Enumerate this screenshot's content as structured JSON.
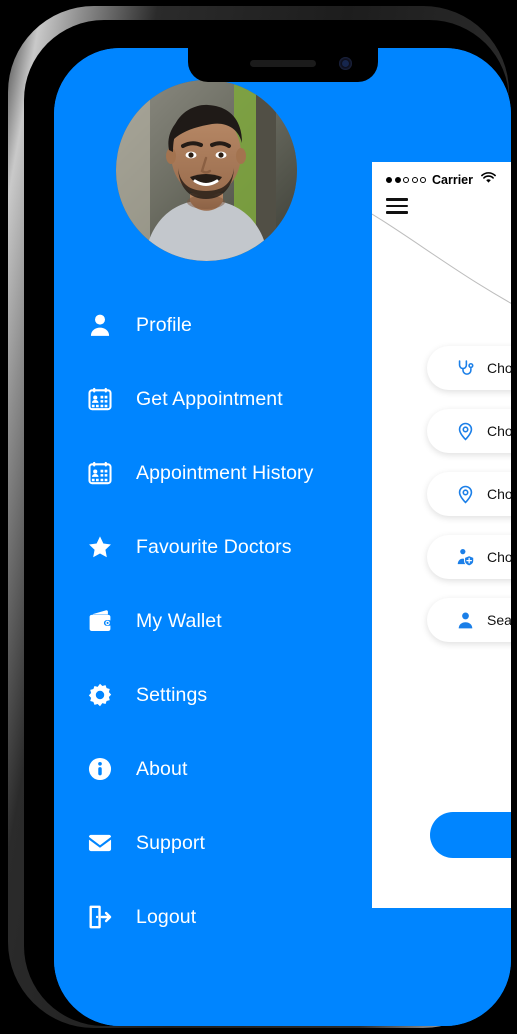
{
  "app": {
    "accent_color": "#0085ff",
    "panel_color": "#ffffff"
  },
  "drawer": {
    "avatar": {
      "icon": "user-photo-avatar",
      "alt": "Profile photo of a smiling man in a grey t-shirt"
    },
    "items": [
      {
        "icon": "person-icon",
        "label": "Profile"
      },
      {
        "icon": "calendar-icon",
        "label": "Get Appointment"
      },
      {
        "icon": "calendar-icon",
        "label": "Appointment History"
      },
      {
        "icon": "star-icon",
        "label": "Favourite Doctors"
      },
      {
        "icon": "wallet-icon",
        "label": "My Wallet"
      },
      {
        "icon": "gear-icon",
        "label": "Settings"
      },
      {
        "icon": "info-icon",
        "label": "About"
      },
      {
        "icon": "envelope-icon",
        "label": "Support"
      },
      {
        "icon": "logout-icon",
        "label": "Logout"
      }
    ]
  },
  "content_panel": {
    "status_bar": {
      "signal_dots_filled": 2,
      "signal_dots_total": 5,
      "carrier": "Carrier",
      "wifi_icon": "wifi-icon"
    },
    "menu_button": "hamburger-icon",
    "cards": [
      {
        "icon": "stethoscope-icon",
        "label": "Cho"
      },
      {
        "icon": "location-pin-icon",
        "label": "Cho"
      },
      {
        "icon": "location-pin-icon",
        "label": "Cho"
      },
      {
        "icon": "doctor-shield-icon",
        "label": "Cho"
      },
      {
        "icon": "user-avatar-icon",
        "label": "Sea"
      }
    ],
    "primary_button": {
      "label": ""
    }
  }
}
